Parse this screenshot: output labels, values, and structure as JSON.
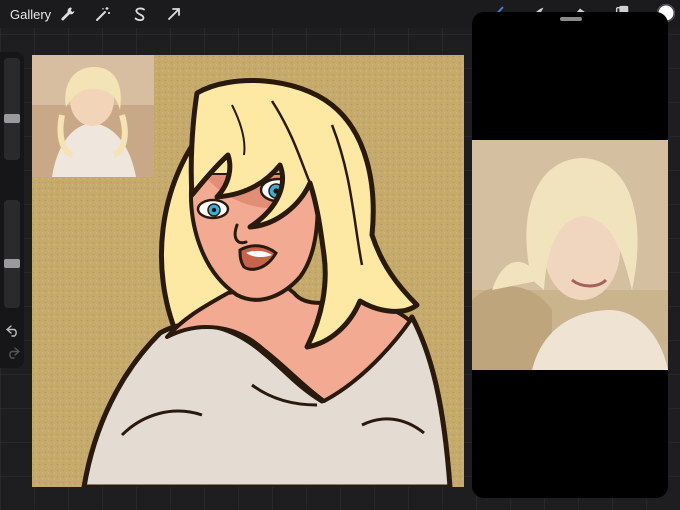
{
  "topbar": {
    "gallery_label": "Gallery",
    "left_tools": [
      "wrench-icon",
      "magic-wand-icon",
      "selection-s-icon",
      "transform-arrow-icon"
    ],
    "right_tools": [
      "brush-icon",
      "smudge-icon",
      "eraser-icon",
      "layers-icon"
    ],
    "active_color": "#ffffff"
  },
  "sidebar": {
    "brush_size": 0.4,
    "brush_opacity": 0.4
  },
  "canvas": {
    "background_color": "#c6aa6c",
    "hair_color": "#fde9a3",
    "skin_color": "#f2ab92",
    "sweater_color": "#e4dcd3",
    "outline_color": "#2a1a0e",
    "eye_color": "#3ab0d6"
  },
  "reference_panel": {
    "photo_bg": "#d4c0a1"
  }
}
